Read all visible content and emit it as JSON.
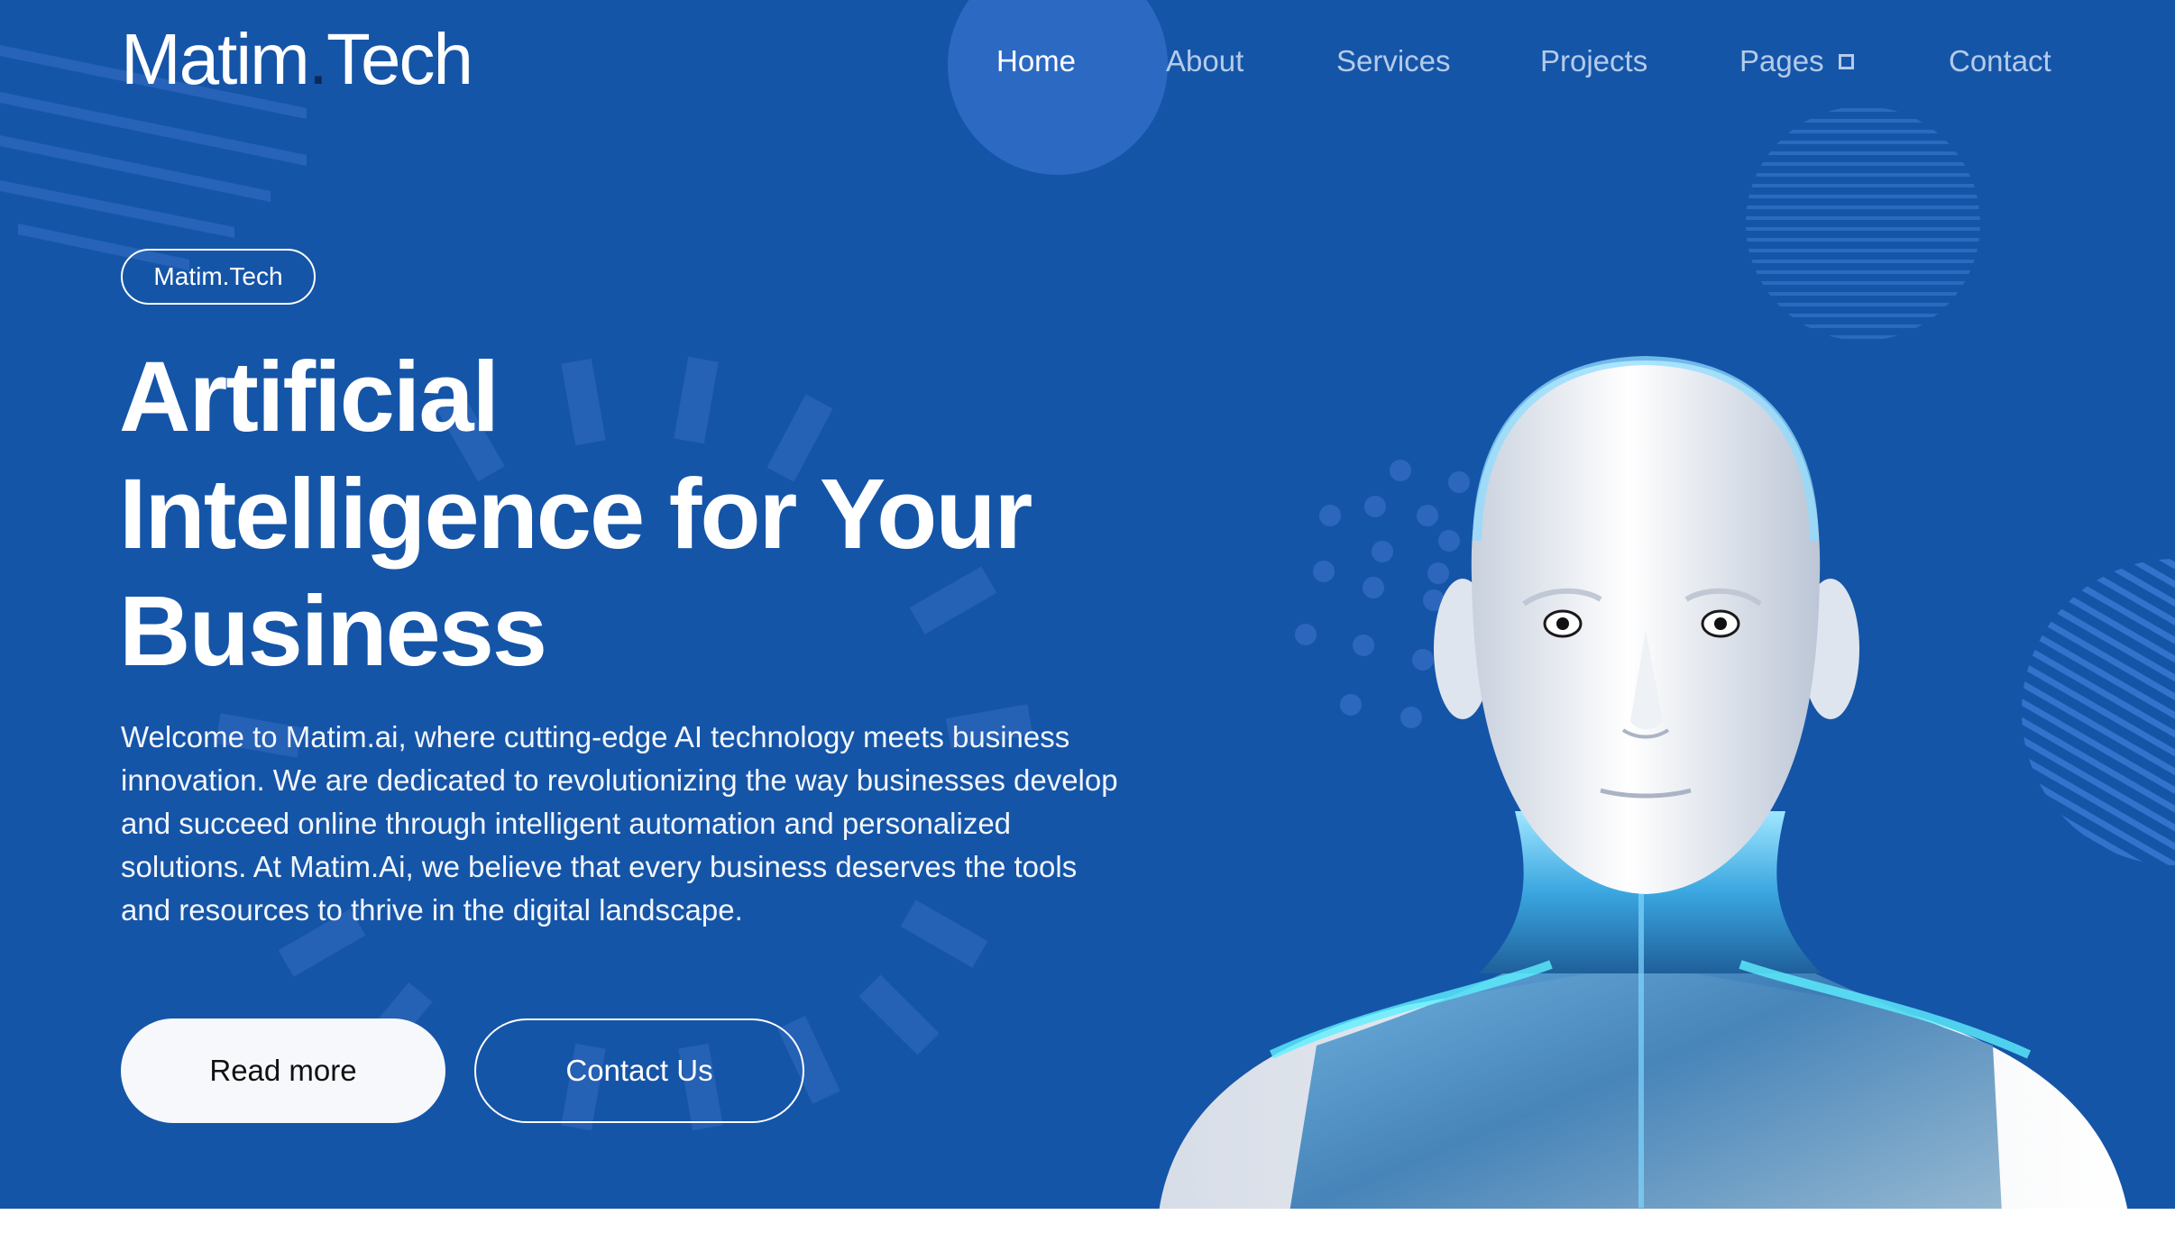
{
  "header": {
    "logo_part1": "Matim",
    "logo_dot": ".",
    "logo_part2": "Tech",
    "nav": [
      {
        "label": "Home",
        "active": true
      },
      {
        "label": "About"
      },
      {
        "label": "Services"
      },
      {
        "label": "Projects"
      },
      {
        "label": "Pages",
        "icon": "square-dropdown-icon"
      },
      {
        "label": "Contact"
      }
    ]
  },
  "hero": {
    "badge": "Matim.Tech",
    "headline_lines": [
      "Artificial",
      "Intelligence for Your",
      "Business"
    ],
    "lead": "Welcome to Matim.ai, where cutting-edge AI technology meets business innovation. We are dedicated to revolutionizing the way businesses develop and succeed online through intelligent automation and personalized solutions. At Matim.Ai, we believe that every business deserves the tools and resources to thrive in the digital landscape.",
    "primary_button": "Read more",
    "secondary_button": "Contact Us",
    "image": "humanoid-robot-illustration"
  },
  "colors": {
    "background": "#1555a8",
    "accent_light": "#2a6bc4",
    "nav_inactive": "#b4cbea",
    "text": "#ffffff",
    "button_fill": "#f6f8fb",
    "logo_dot": "#0c2a55"
  }
}
